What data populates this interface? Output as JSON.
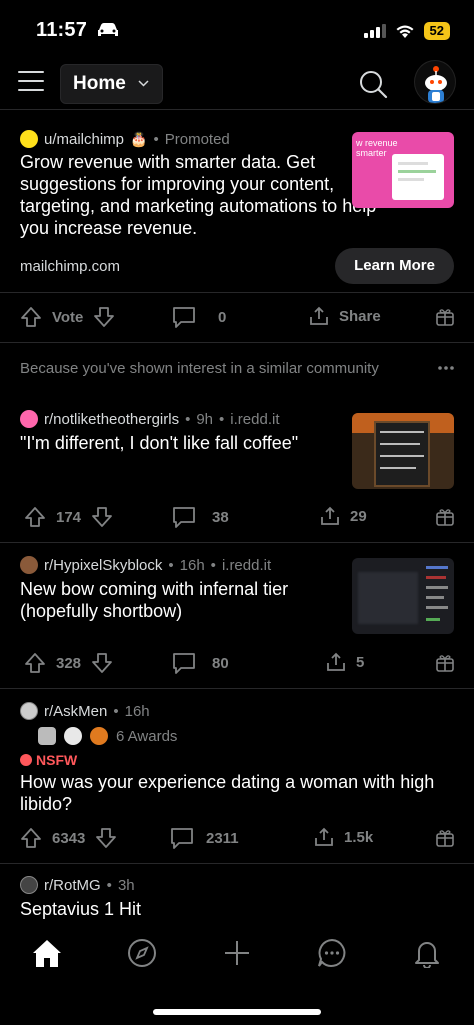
{
  "status": {
    "time": "11:57",
    "battery": "52"
  },
  "header": {
    "feed_label": "Home"
  },
  "promoted_post": {
    "subreddit": "u/mailchimp",
    "tag": "Promoted",
    "title": "Grow revenue with smarter data. Get suggestions for improving your content, targeting, and marketing automations to help you increase revenue.",
    "domain": "mailchimp.com",
    "cta": "Learn More",
    "vote_label": "Vote",
    "comments": "0",
    "share_label": "Share",
    "thumb_text": "w revenue\nsmarter"
  },
  "recommendation": {
    "text": "Because you've shown interest in a similar community"
  },
  "posts": [
    {
      "subreddit": "r/notliketheothergirls",
      "age": "9h",
      "domain": "i.redd.it",
      "title": "\"I'm different, I don't like fall coffee\"",
      "votes": "174",
      "comments": "38",
      "shares": "29",
      "icon_color": "#ff66ac"
    },
    {
      "subreddit": "r/HypixelSkyblock",
      "age": "16h",
      "domain": "i.redd.it",
      "title": "New bow coming with infernal tier (hopefully shortbow)",
      "votes": "328",
      "comments": "80",
      "shares": "5",
      "icon_color": "#8a5a3a"
    },
    {
      "subreddit": "r/AskMen",
      "age": "16h",
      "awards": "6 Awards",
      "nsfw": "NSFW",
      "title": "How was your experience dating a woman with high libido?",
      "votes": "6343",
      "comments": "2311",
      "shares": "1.5k",
      "icon_color": "#cccccc"
    },
    {
      "subreddit": "r/RotMG",
      "age": "3h",
      "title": "Septavius 1 Hit",
      "icon_color": "#444444"
    }
  ],
  "colors": {
    "background": "#000000",
    "divider": "#272729",
    "text": "#d7dadc",
    "muted": "#818384",
    "nsfw": "#ff585b"
  }
}
